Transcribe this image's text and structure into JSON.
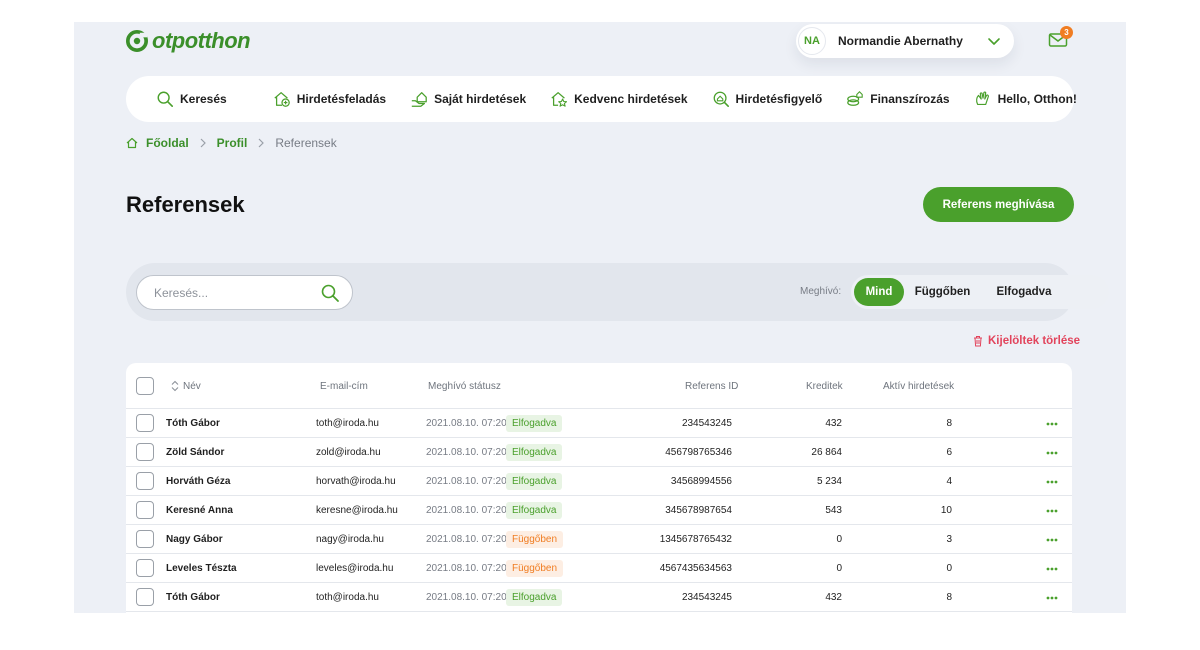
{
  "brand": {
    "name": "otpotthon"
  },
  "user": {
    "initials": "NA",
    "name": "Normandie Abernathy"
  },
  "mail": {
    "badge": "3"
  },
  "nav": {
    "search": "Keresés",
    "items": [
      "Hirdetésfeladás",
      "Saját hirdetések",
      "Kedvenc hirdetések",
      "Hirdetésfigyelő",
      "Finanszírozás",
      "Hello, Otthon!"
    ]
  },
  "breadcrumb": {
    "home": "Főoldal",
    "profile": "Profil",
    "current": "Referensek"
  },
  "page": {
    "title": "Referensek",
    "invite_button": "Referens meghívása"
  },
  "filter": {
    "search_placeholder": "Keresés...",
    "label": "Meghívó:",
    "options": [
      "Mind",
      "Függőben",
      "Elfogadva"
    ],
    "active": "Mind"
  },
  "delete_selected": "Kijelöltek törlése",
  "table": {
    "headers": {
      "name": "Név",
      "email": "E-mail-cím",
      "status": "Meghívó státusz",
      "ref_id": "Referens ID",
      "credits": "Kreditek",
      "active_ads": "Aktív hirdetések"
    },
    "rows": [
      {
        "name": "Tóth Gábor",
        "email": "toth@iroda.hu",
        "date": "2021.08.10. 07:20",
        "status": "Elfogadva",
        "status_type": "ok",
        "ref_id": "234543245",
        "credits": "432",
        "ads": "8"
      },
      {
        "name": "Zöld Sándor",
        "email": "zold@iroda.hu",
        "date": "2021.08.10. 07:20",
        "status": "Elfogadva",
        "status_type": "ok",
        "ref_id": "456798765346",
        "credits": "26 864",
        "ads": "6"
      },
      {
        "name": "Horváth Géza",
        "email": "horvath@iroda.hu",
        "date": "2021.08.10. 07:20",
        "status": "Elfogadva",
        "status_type": "ok",
        "ref_id": "34568994556",
        "credits": "5 234",
        "ads": "4"
      },
      {
        "name": "Keresné Anna",
        "email": "keresne@iroda.hu",
        "date": "2021.08.10. 07:20",
        "status": "Elfogadva",
        "status_type": "ok",
        "ref_id": "345678987654",
        "credits": "543",
        "ads": "10"
      },
      {
        "name": "Nagy Gábor",
        "email": "nagy@iroda.hu",
        "date": "2021.08.10. 07:20",
        "status": "Függőben",
        "status_type": "pend",
        "ref_id": "1345678765432",
        "credits": "0",
        "ads": "3"
      },
      {
        "name": "Leveles Tészta",
        "email": "leveles@iroda.hu",
        "date": "2021.08.10. 07:20",
        "status": "Függőben",
        "status_type": "pend",
        "ref_id": "4567435634563",
        "credits": "0",
        "ads": "0"
      },
      {
        "name": "Tóth Gábor",
        "email": "toth@iroda.hu",
        "date": "2021.08.10. 07:20",
        "status": "Elfogadva",
        "status_type": "ok",
        "ref_id": "234543245",
        "credits": "432",
        "ads": "8"
      }
    ]
  },
  "colors": {
    "brand_green": "#4aa02c",
    "pending_orange": "#f07d22",
    "danger_red": "#e2445c",
    "background": "#edf0f6"
  }
}
